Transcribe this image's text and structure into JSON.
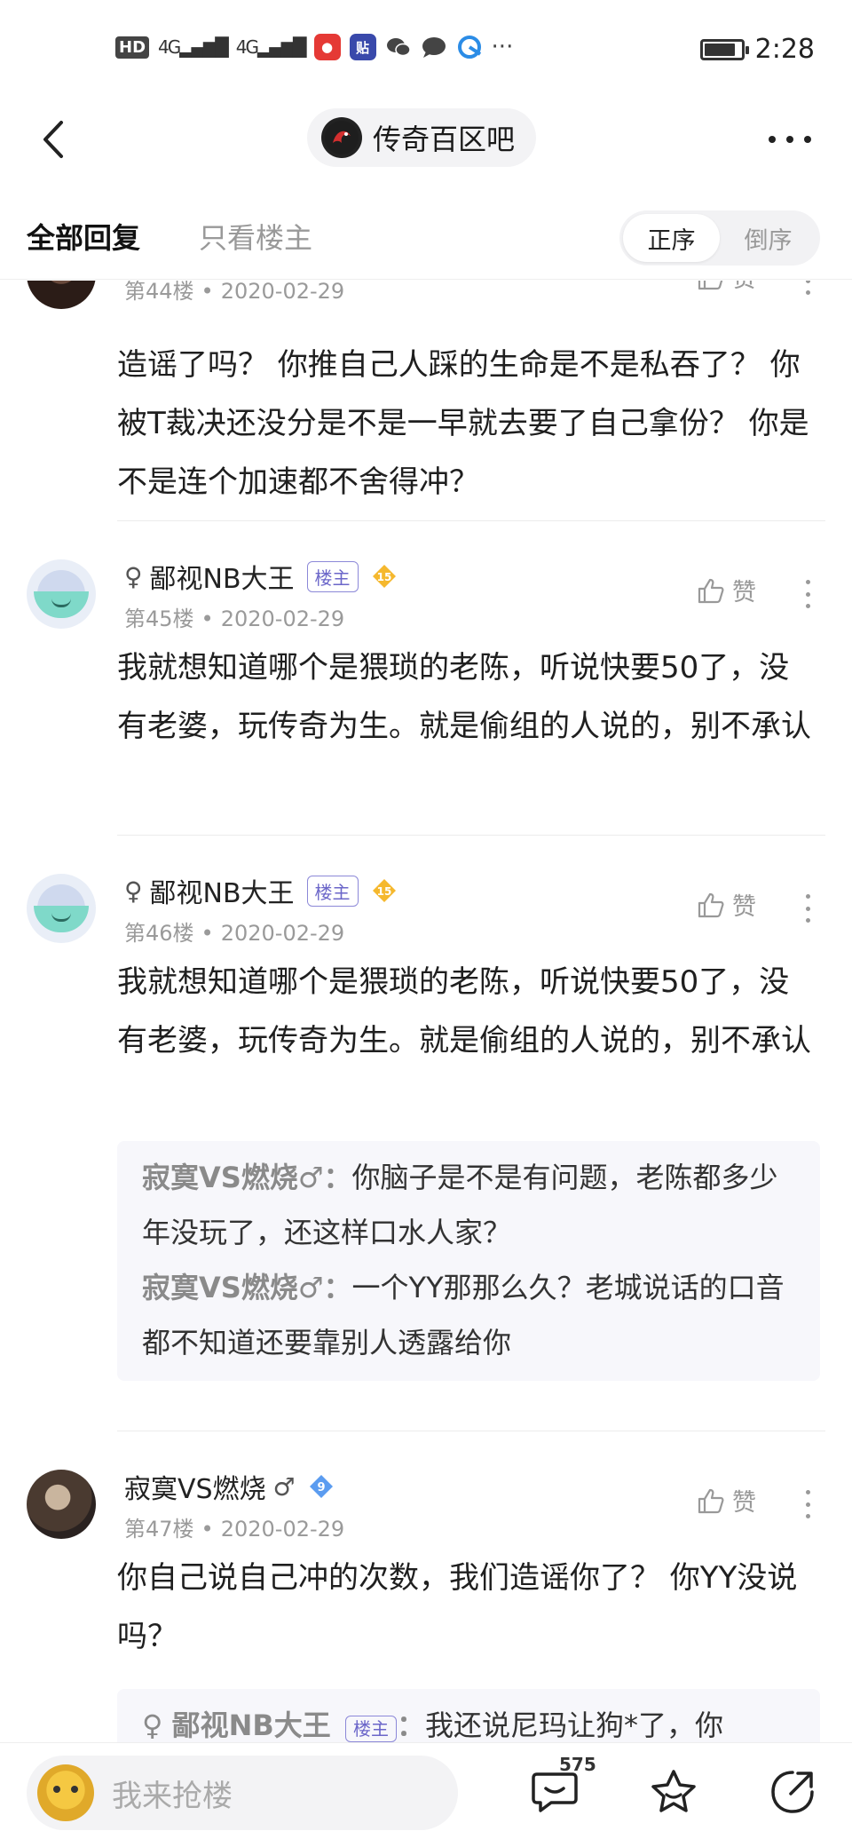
{
  "status_bar": {
    "hd": "HD",
    "signal1": "4G",
    "signal2": "4G",
    "tieba_app_label": "贴",
    "time": "2:28",
    "battery_level": 0.85
  },
  "nav": {
    "forum_name": "传奇百区吧"
  },
  "filter": {
    "all_replies": "全部回复",
    "only_owner": "只看楼主",
    "order_asc": "正序",
    "order_desc": "倒序"
  },
  "floors": [
    {
      "floor": "第44楼",
      "date": "2020-02-29",
      "like": "赞",
      "content": "造谣了吗？ 你推自己人踩的生命是不是私吞了？ 你被T裁决还没分是不是一早就去要了自己拿份？ 你是不是连个加速都不舍得冲？"
    },
    {
      "gender": "♀",
      "name": "鄙视NB大王",
      "owner_badge": "楼主",
      "level": "15",
      "floor": "第45楼",
      "date": "2020-02-29",
      "like": "赞",
      "content": "我就想知道哪个是猥琐的老陈，听说快要50了，没有老婆，玩传奇为生。就是偷组的人说的，别不承认"
    },
    {
      "gender": "♀",
      "name": "鄙视NB大王",
      "owner_badge": "楼主",
      "level": "15",
      "floor": "第46楼",
      "date": "2020-02-29",
      "like": "赞",
      "content": "我就想知道哪个是猥琐的老陈，听说快要50了，没有老婆，玩传奇为生。就是偷组的人说的，别不承认",
      "replies": [
        {
          "author": "寂寞VS燃烧",
          "gender": "♂",
          "sep": "：",
          "text": "你脑子是不是有问题，老陈都多少年没玩了，还这样口水人家？"
        },
        {
          "author": "寂寞VS燃烧",
          "gender": "♂",
          "sep": "：",
          "text": "一个YY那那么久？老城说话的口音都不知道还要靠别人透露给你"
        }
      ]
    },
    {
      "name": "寂寞VS燃烧",
      "gender": "♂",
      "level": "9",
      "floor": "第47楼",
      "date": "2020-02-29",
      "like": "赞",
      "content": "你自己说自己冲的次数，我们造谣你了？ 你YY没说吗？",
      "replies": [
        {
          "author": "鄙视NB大王",
          "gender": "♀",
          "owner_badge": "楼主",
          "sep": "：",
          "text": "我还说尼玛让狗*了，你"
        }
      ]
    }
  ],
  "bottom": {
    "input_placeholder": "我来抢楼",
    "comment_count": "575"
  },
  "colors": {
    "accent_purple": "#6b66c9",
    "level_gold": "#f5b82e",
    "level_blue": "#5b9cf0",
    "mask_green": "#7fd9c9"
  }
}
